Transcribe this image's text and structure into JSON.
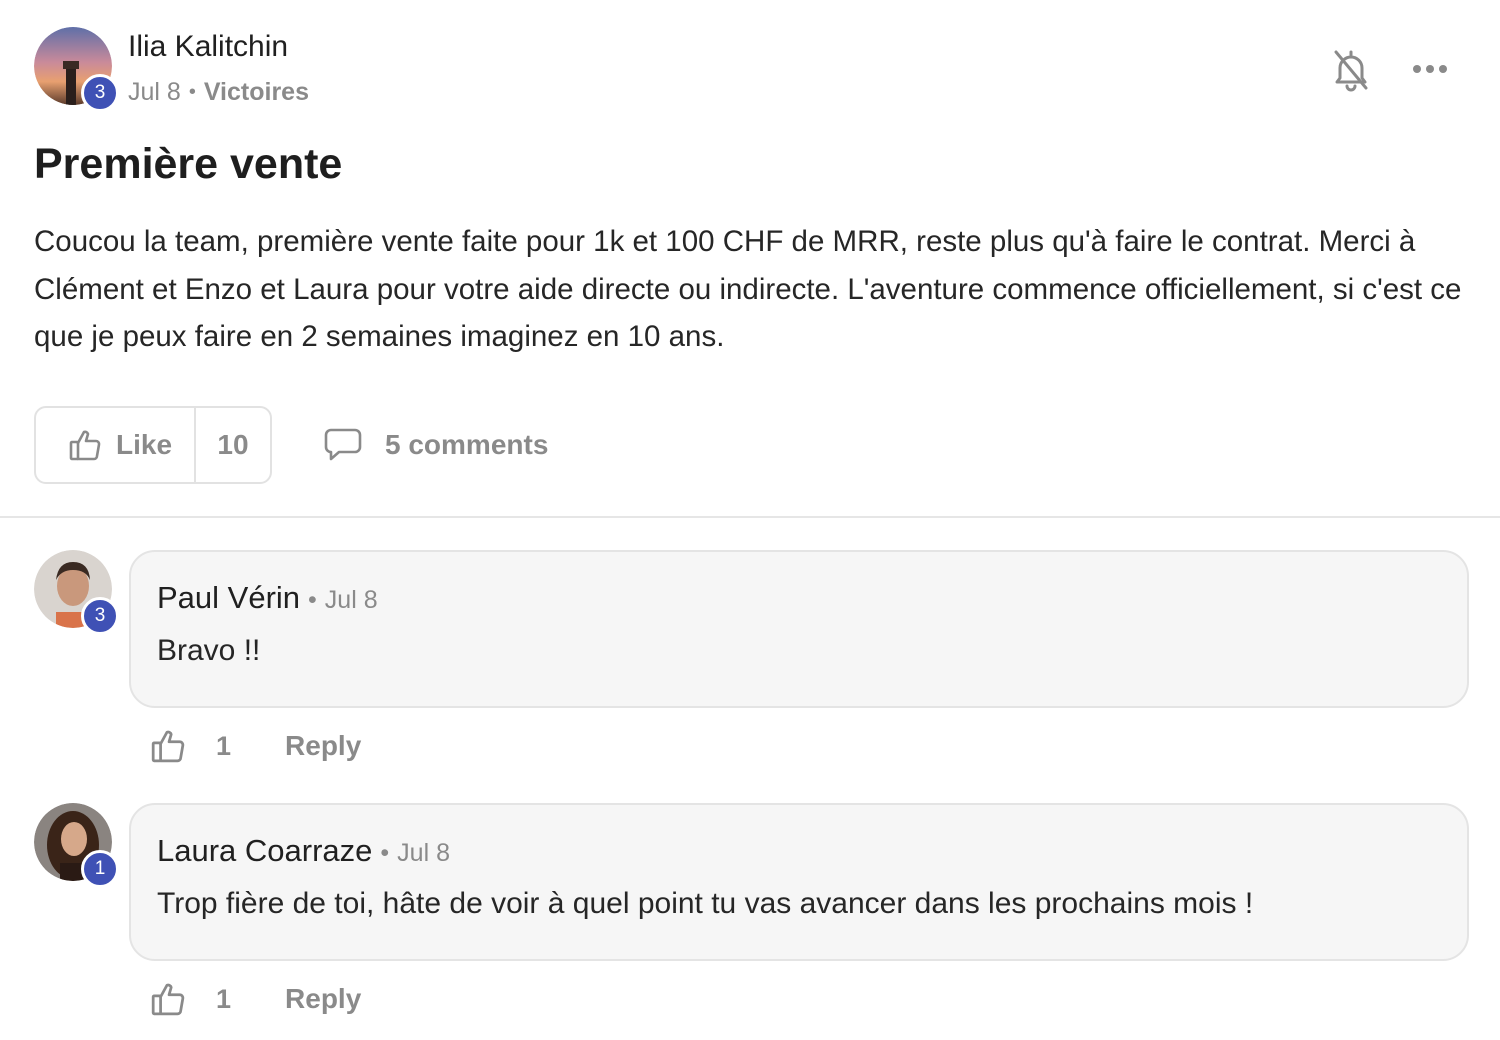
{
  "post": {
    "author": {
      "name": "Ilia Kalitchin",
      "level": "3"
    },
    "date": "Jul 8",
    "separator": "•",
    "category": "Victoires",
    "title": "Première vente",
    "body": "Coucou la team, première vente faite pour 1k et 100 CHF de MRR, reste plus qu'à faire le contrat. Merci à Clément et Enzo et Laura pour votre aide directe ou indirecte. L'aventure commence officiellement, si c'est ce que je peux faire en 2 semaines imaginez en 10 ans.",
    "like_label": "Like",
    "like_count": "10",
    "comments_label": "5 comments"
  },
  "icons": {
    "bell": "bell-off-icon",
    "more": "more-horizontal-icon",
    "like": "thumbs-up-icon",
    "comment": "speech-bubble-icon"
  },
  "colors": {
    "badge": "#3f51b5",
    "muted_text": "#8a8a8a",
    "bubble_bg": "#f6f6f6"
  },
  "comments": [
    {
      "author": "Paul Vérin",
      "level": "3",
      "separator": "•",
      "date": "Jul 8",
      "text": "Bravo !!",
      "like_count": "1",
      "reply_label": "Reply"
    },
    {
      "author": "Laura Coarraze",
      "level": "1",
      "separator": "•",
      "date": "Jul 8",
      "text": "Trop fière de toi, hâte de voir à quel point tu vas avancer dans les prochains mois !",
      "like_count": "1",
      "reply_label": "Reply"
    }
  ]
}
